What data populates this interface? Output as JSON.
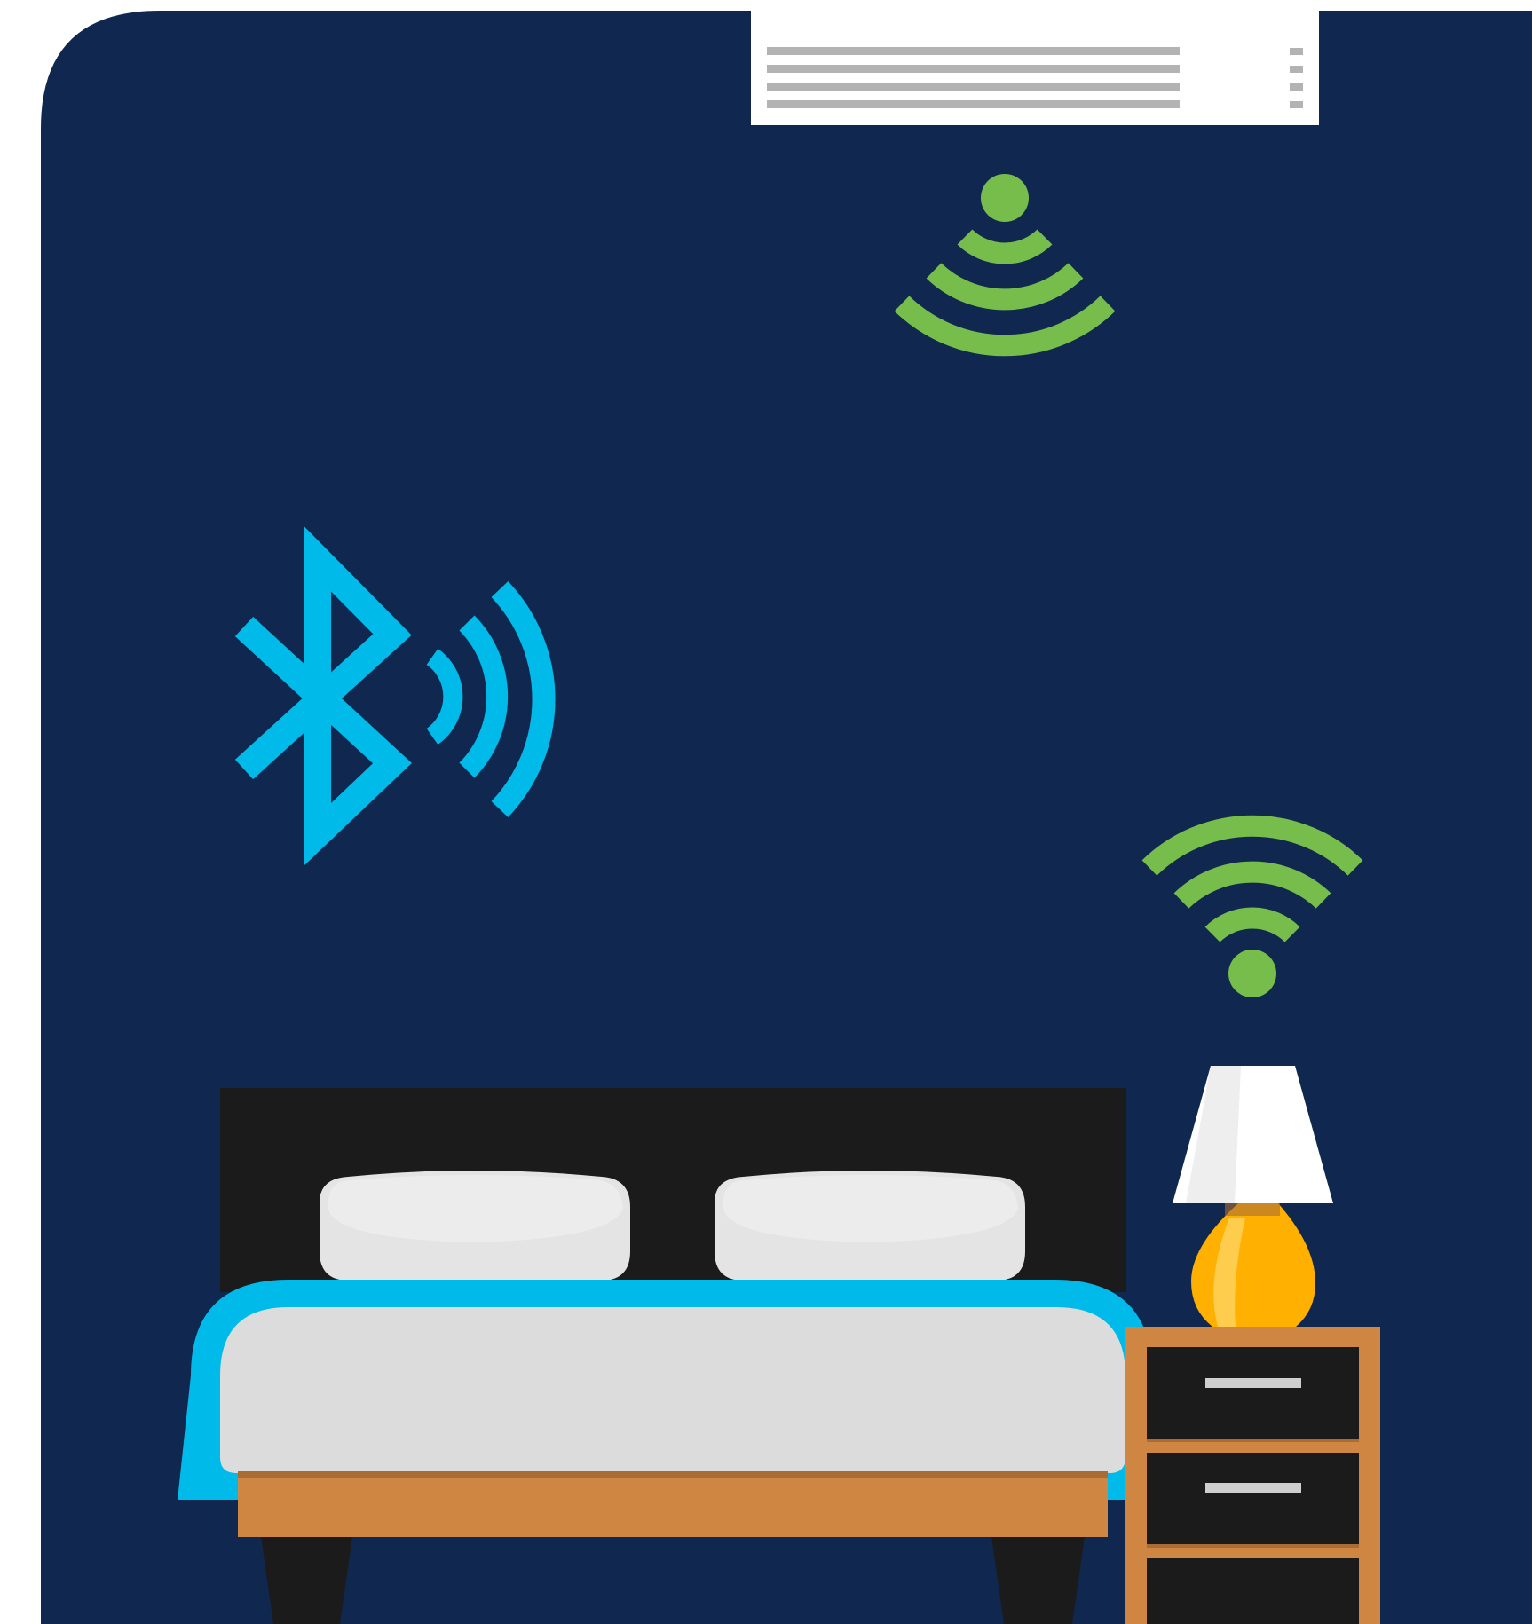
{
  "scene": {
    "title": "",
    "objects": [
      "air-conditioner",
      "wifi-signal",
      "bluetooth-icon",
      "bed",
      "pillow",
      "pillow",
      "bedside-lamp",
      "nightstand"
    ]
  },
  "colors": {
    "wall": "#10284f",
    "ac_body": "#ffffff",
    "ac_vent": "#b3b3b3",
    "wifi": "#76bd4c",
    "bluetooth": "#00bbe9",
    "headboard": "#1b1b1b",
    "pillow": "#e4e4e4",
    "pillow_highlight": "#ececec",
    "blanket_trim": "#00bbe9",
    "mattress": "#dcdcdc",
    "wood": "#ce8642",
    "wood_dark": "#a86c35",
    "legs": "#1b1b1b",
    "lamp_shade": "#ffffff",
    "lamp_shade_shadow": "#eeeeee",
    "lamp_base": "#ffb000",
    "lamp_base_highlight": "#ffcd4d",
    "drawer": "#1b1b1b",
    "handle": "#cfcfcf"
  },
  "icons": {
    "ceiling_wifi": "wifi-icon",
    "lamp_wifi": "wifi-icon",
    "bluetooth": "bluetooth-icon"
  }
}
